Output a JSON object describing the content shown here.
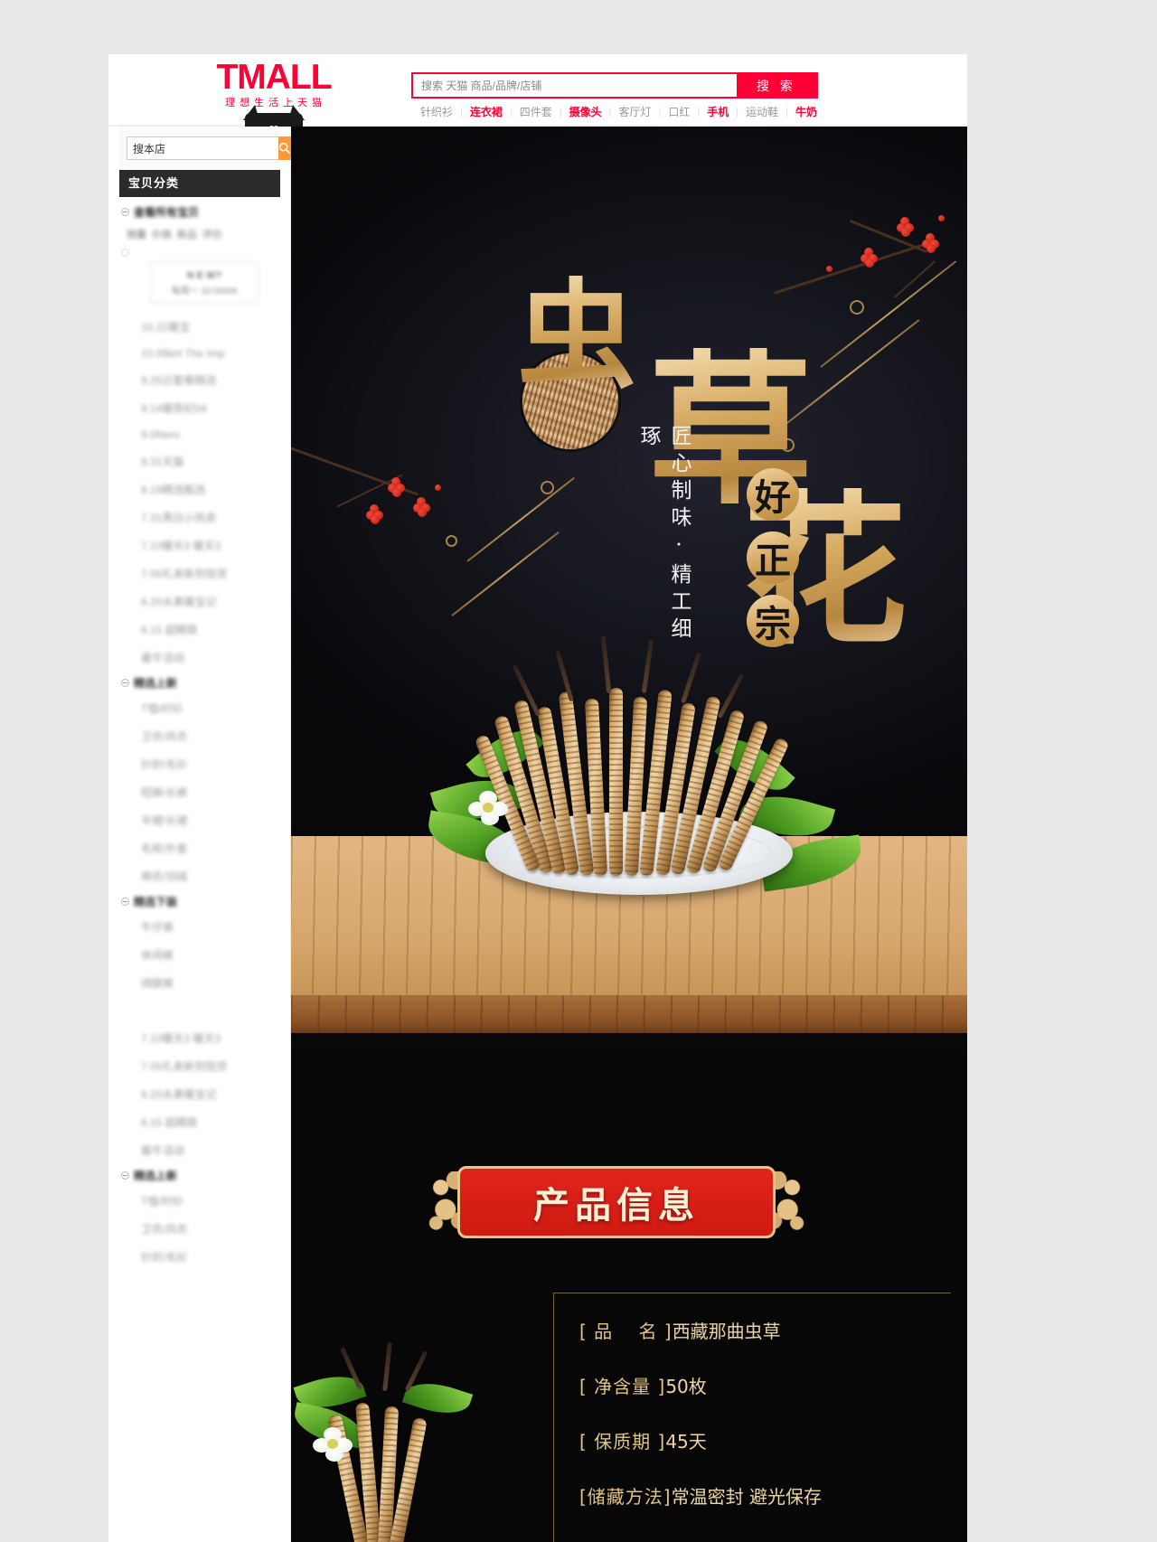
{
  "header": {
    "logo_word": "TMALL",
    "logo_tagline": "理想生活上天猫",
    "search_placeholder": "搜索 天猫 商品/品牌/店铺",
    "search_value": "",
    "search_button": "搜 索",
    "hot_keywords": [
      {
        "label": "针织衫",
        "hot": false
      },
      {
        "label": "连衣裙",
        "hot": true
      },
      {
        "label": "四件套",
        "hot": false
      },
      {
        "label": "摄像头",
        "hot": true
      },
      {
        "label": "客厅灯",
        "hot": false
      },
      {
        "label": "口红",
        "hot": false
      },
      {
        "label": "手机",
        "hot": true
      },
      {
        "label": "运动鞋",
        "hot": false
      },
      {
        "label": "牛奶",
        "hot": true
      }
    ]
  },
  "sidebar": {
    "shop_search_value": "搜本店",
    "shop_search_icon": "search-icon",
    "category_title": "宝贝分类",
    "view_all": "查看所有宝贝",
    "sort_tags": [
      "销量",
      "价格",
      "新品",
      "评价"
    ],
    "promo": {
      "line1": "N E W?",
      "line2": "每周一 10:00AM"
    },
    "groups": [
      {
        "label": "查看所有宝贝",
        "items": [
          "10.22暖宝",
          "10.06kirl The Imp",
          "9.25日套餐精选",
          "9.14暖荐纪04",
          "9.0Nero",
          "9.31天猫",
          "9.19精选甄选",
          "7.31黑白小热卖",
          "7.10暖天3 暖天3",
          "7.05礼来新到现货",
          "6.20水果暖宝记",
          "6.15 超精致",
          "最牛活动"
        ]
      },
      {
        "label": "精选上新",
        "items": [
          "T恤/衬衫",
          "卫衣/风衣",
          "针织/毛衫",
          "短裤/长裤",
          "半裙/长裙",
          "毛呢/外套",
          "棉衣/羽绒"
        ]
      },
      {
        "label": "精选下装",
        "items": [
          "牛仔裤",
          "休闲裤",
          "阔腿裤"
        ]
      },
      {
        "label": "",
        "items": [
          "7.10暖天3 暖天3",
          "7.05礼来新到现货",
          "6.20水果暖宝记",
          "6.15 超精致",
          "最牛活动"
        ]
      },
      {
        "label": "精选上新",
        "items": [
          "T恤/衬衫",
          "卫衣/风衣",
          "针织/毛衫"
        ]
      }
    ]
  },
  "hero": {
    "title_chars": [
      "虫",
      "草",
      "花"
    ],
    "seal_chars": [
      "好",
      "正",
      "宗"
    ],
    "vertical_slogan": "匠心制味·精工细琢",
    "inset_image_name": "cordyceps-closeup",
    "background_color": "#08080b",
    "gold_color": "#d5a960"
  },
  "product_info": {
    "banner_title": "产品信息",
    "banner_color": "#d5201a",
    "banner_border_color": "#e8c88a",
    "rows": [
      {
        "key": "[ 品　 名 ]",
        "value": "西藏那曲虫草"
      },
      {
        "key": "[ 净含量 ]",
        "value": "50枚"
      },
      {
        "key": "[ 保质期 ]",
        "value": "45天"
      },
      {
        "key": "[储藏方法]",
        "value": "常温密封 避光保存"
      }
    ]
  }
}
